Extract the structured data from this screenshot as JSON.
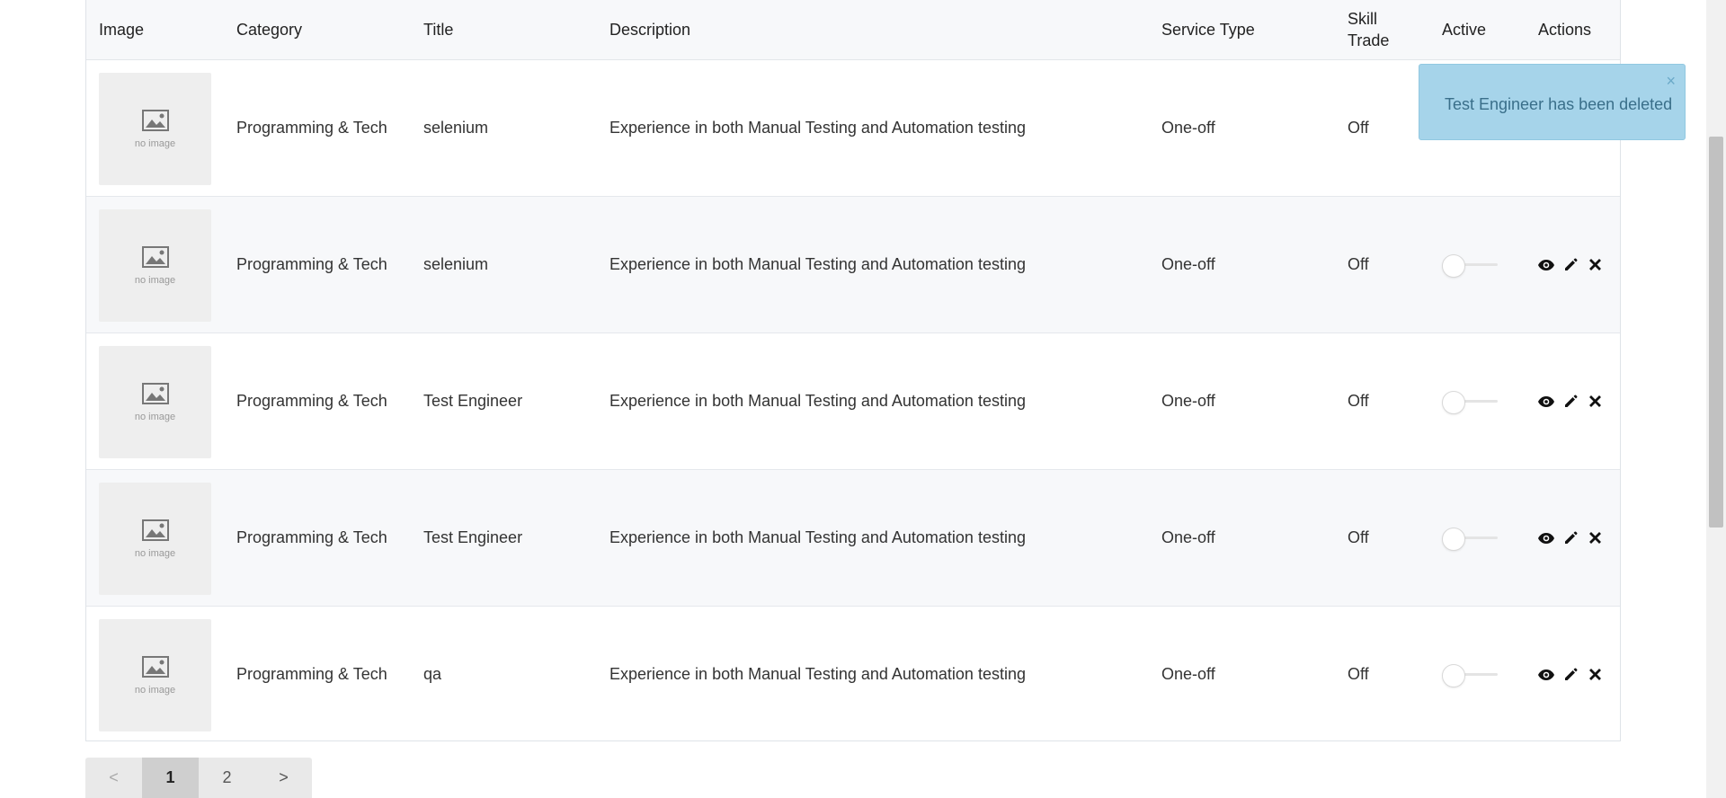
{
  "table": {
    "headers": {
      "image": "Image",
      "category": "Category",
      "title": "Title",
      "description": "Description",
      "service_type": "Service Type",
      "skill_trade": "Skill Trade",
      "active": "Active",
      "actions": "Actions"
    },
    "no_image_label": "no image",
    "rows": [
      {
        "category": "Programming & Tech",
        "title": "selenium",
        "description": "Experience in both Manual Testing and Automation testing",
        "service_type": "One-off",
        "skill_trade": "Off",
        "active": false
      },
      {
        "category": "Programming & Tech",
        "title": "selenium",
        "description": "Experience in both Manual Testing and Automation testing",
        "service_type": "One-off",
        "skill_trade": "Off",
        "active": false
      },
      {
        "category": "Programming & Tech",
        "title": "Test Engineer",
        "description": "Experience in both Manual Testing and Automation testing",
        "service_type": "One-off",
        "skill_trade": "Off",
        "active": false
      },
      {
        "category": "Programming & Tech",
        "title": "Test Engineer",
        "description": "Experience in both Manual Testing and Automation testing",
        "service_type": "One-off",
        "skill_trade": "Off",
        "active": false
      },
      {
        "category": "Programming & Tech",
        "title": "qa",
        "description": "Experience in both Manual Testing and Automation testing",
        "service_type": "One-off",
        "skill_trade": "Off",
        "active": false
      }
    ],
    "action_icons": [
      "eye-icon",
      "pencil-icon",
      "close-icon"
    ]
  },
  "toast": {
    "message": "Test Engineer has been deleted",
    "close_label": "×",
    "color": "#a6d4ea"
  },
  "pagination": {
    "prev": "<",
    "pages": [
      "1",
      "2"
    ],
    "current": "1",
    "next": ">"
  }
}
